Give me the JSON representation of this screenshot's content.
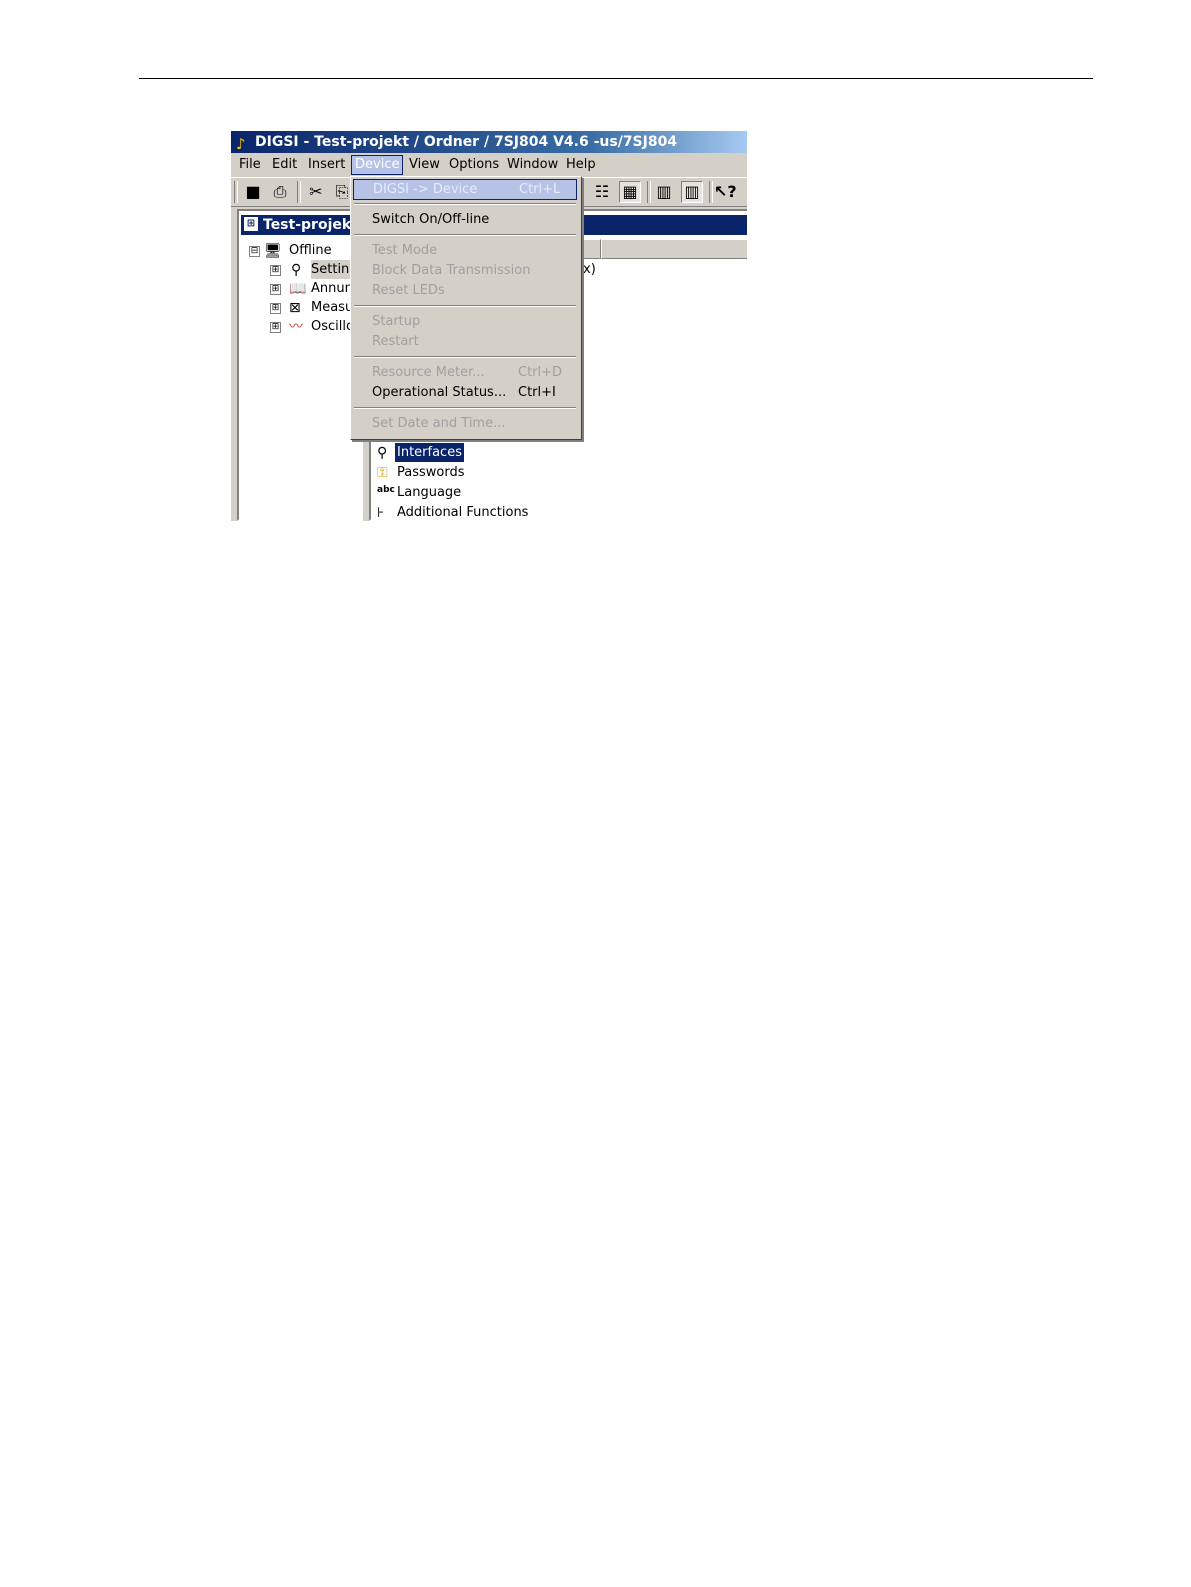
{
  "window": {
    "title": "DIGSI - Test-projekt / Ordner / 7SJ804 V4.6 -us/7SJ804"
  },
  "menubar": {
    "items": [
      {
        "label": "File"
      },
      {
        "label": "Edit"
      },
      {
        "label": "Insert"
      },
      {
        "label": "Device"
      },
      {
        "label": "View"
      },
      {
        "label": "Options"
      },
      {
        "label": "Window"
      },
      {
        "label": "Help"
      }
    ],
    "active": "Device"
  },
  "toolbar": {
    "icons": [
      "save-icon",
      "print-icon",
      "cut-icon",
      "copy-icon",
      "list-view-icon",
      "details-view-icon",
      "device-icon",
      "device-pressed-icon",
      "context-help-icon"
    ]
  },
  "left_pane": {
    "title": "Test-projekt",
    "tree": [
      {
        "label": "Offline",
        "expander": "⊟",
        "icon": "computer-icon"
      },
      {
        "label": "Settings",
        "expander": "⊞",
        "icon": "settings-icon"
      },
      {
        "label": "Annunciation",
        "expander": "⊞",
        "icon": "annunciation-icon"
      },
      {
        "label": "Measurement",
        "expander": "⊞",
        "icon": "measurement-icon"
      },
      {
        "label": "Oscillographic Records",
        "expander": "⊞",
        "icon": "oscillograph-icon"
      }
    ]
  },
  "right_pane": {
    "partial_text": "x)",
    "items": [
      {
        "label": "Interfaces",
        "icon": "interfaces-icon",
        "selected": true
      },
      {
        "label": "Passwords",
        "icon": "key-icon"
      },
      {
        "label": "Language",
        "icon": "abc-icon",
        "glyph": "abc"
      },
      {
        "label": "Additional Functions",
        "icon": "functions-icon"
      }
    ]
  },
  "device_menu": {
    "items": [
      {
        "label": "DIGSI -> Device",
        "shortcut": "Ctrl+L",
        "enabled": false,
        "hover": true
      },
      {
        "label": "Switch On/Off-line",
        "shortcut": "",
        "enabled": true
      },
      {
        "label": "Test Mode",
        "shortcut": "",
        "enabled": false
      },
      {
        "label": "Block Data Transmission",
        "shortcut": "",
        "enabled": false
      },
      {
        "label": "Reset LEDs",
        "shortcut": "",
        "enabled": false
      },
      {
        "label": "Startup",
        "shortcut": "",
        "enabled": false
      },
      {
        "label": "Restart",
        "shortcut": "",
        "enabled": false
      },
      {
        "label": "Resource Meter...",
        "shortcut": "Ctrl+D",
        "enabled": false
      },
      {
        "label": "Operational Status...",
        "shortcut": "Ctrl+I",
        "enabled": true
      },
      {
        "label": "Set Date and Time...",
        "shortcut": "",
        "enabled": false
      }
    ]
  }
}
